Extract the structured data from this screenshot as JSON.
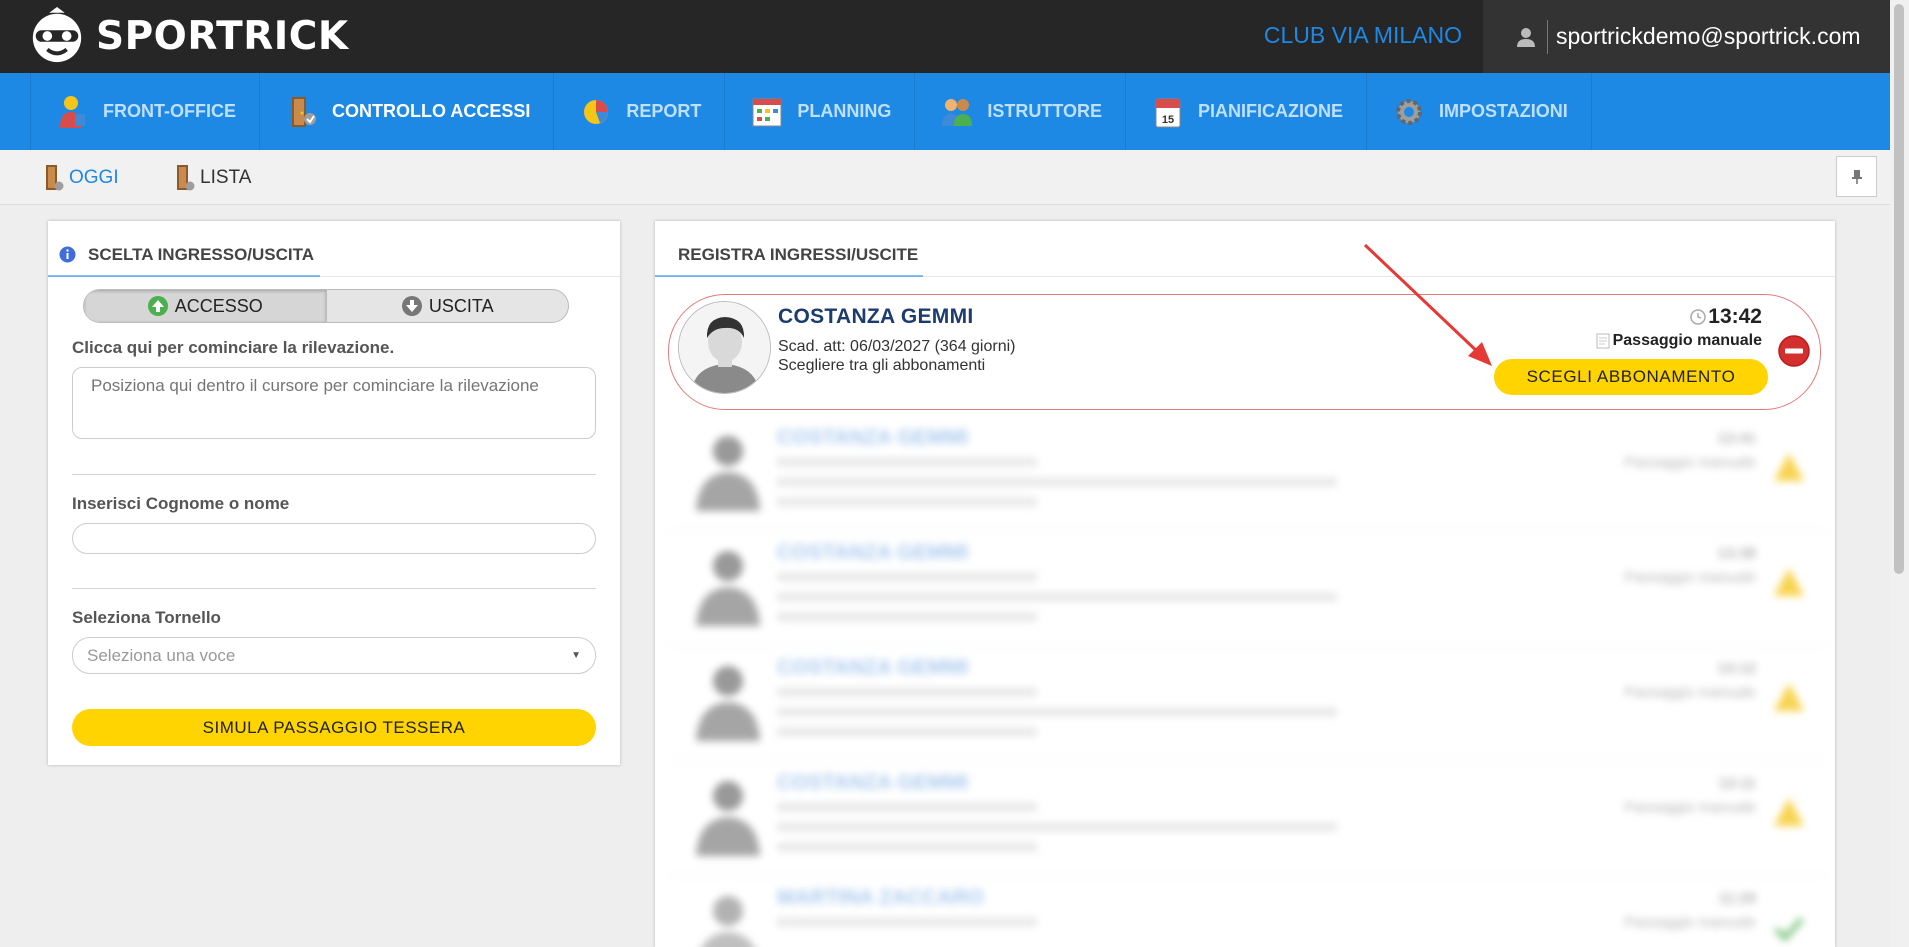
{
  "brand": {
    "name": "SPORTRICK"
  },
  "header": {
    "club": "CLUB VIA MILANO",
    "user_email": "sportrickdemo@sportrick.com"
  },
  "nav": {
    "items": [
      {
        "label": "FRONT-OFFICE",
        "icon": "front-office-icon",
        "active": false
      },
      {
        "label": "CONTROLLO ACCESSI",
        "icon": "access-control-icon",
        "active": true
      },
      {
        "label": "REPORT",
        "icon": "report-icon",
        "active": false
      },
      {
        "label": "PLANNING",
        "icon": "planning-icon",
        "active": false
      },
      {
        "label": "ISTRUTTORE",
        "icon": "instructor-icon",
        "active": false
      },
      {
        "label": "PIANIFICAZIONE",
        "icon": "calendar-icon",
        "active": false
      },
      {
        "label": "IMPOSTAZIONI",
        "icon": "settings-icon",
        "active": false
      }
    ]
  },
  "subnav": {
    "oggi": "OGGI",
    "lista": "LISTA"
  },
  "left_panel": {
    "title": "SCELTA INGRESSO/USCITA",
    "toggle": {
      "accesso": "ACCESSO",
      "uscita": "USCITA",
      "selected": "ACCESSO"
    },
    "capture_label": "Clicca qui per cominciare la rilevazione.",
    "capture_placeholder": "Posiziona qui dentro il cursore per cominciare la rilevazione",
    "search_label": "Inserisci Cognome o nome",
    "search_value": "",
    "turnstile_label": "Seleziona Tornello",
    "turnstile_value": "Seleziona una voce",
    "simulate_button": "SIMULA PASSAGGIO TESSERA"
  },
  "right_panel": {
    "title": "REGISTRA INGRESSI/USCITE",
    "active_entry": {
      "name": "COSTANZA GEMMI",
      "expiry": "Scad. att: 06/03/2027 (364 giorni)",
      "note": "Scegliere tra gli abbonamenti",
      "time": "13:42",
      "mode": "Passaggio manuale",
      "action": "SCEGLI ABBONAMENTO"
    },
    "blurred_entries": [
      {
        "name": "COSTANZA GEMMI",
        "time": "13:41",
        "mode": "Passaggio manuale",
        "status": "warning"
      },
      {
        "name": "COSTANZA GEMMI",
        "time": "13:38",
        "mode": "Passaggio manuale",
        "status": "warning"
      },
      {
        "name": "COSTANZA GEMMI",
        "time": "13:12",
        "mode": "Passaggio manuale",
        "status": "warning"
      },
      {
        "name": "COSTANZA GEMMI",
        "time": "13:11",
        "mode": "Passaggio manuale",
        "status": "warning"
      },
      {
        "name": "MARTINA ZACCARO",
        "time": "11:29",
        "mode": "Passaggio manuale",
        "status": "ok"
      }
    ]
  },
  "colors": {
    "brand_blue": "#1e88e5",
    "accent_yellow": "#ffd400",
    "topbar": "#262626",
    "alert_red": "#e47b7b"
  }
}
